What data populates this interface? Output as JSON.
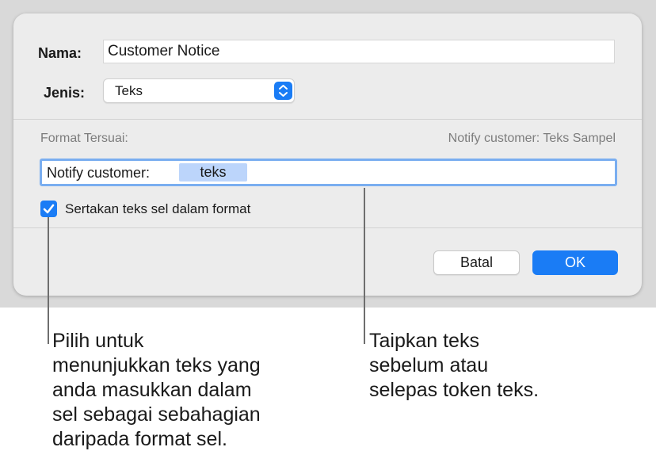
{
  "dialog": {
    "name_label": "Nama:",
    "name_value": "Customer Notice",
    "type_label": "Jenis:",
    "type_value": "Teks",
    "custom_format_label": "Format Tersuai:",
    "sample_text": "Notify customer: Teks Sampel",
    "format_prefix": "Notify customer:",
    "token_label": "teks",
    "include_text_checked": true,
    "include_text_label": "Sertakan teks sel dalam format",
    "cancel_label": "Batal",
    "ok_label": "OK"
  },
  "callouts": {
    "left": "Pilih untuk\nmenunjukkan teks yang\nanda masukkan dalam\nsel sebagai sebahagian\ndaripada format sel.",
    "right": "Taipkan teks\nsebelum atau\nselepas token teks."
  },
  "colors": {
    "accent": "#1a7cf5",
    "token_fill": "#bcd5fb",
    "focus_ring": "#7aaef0",
    "dialog_bg": "#ececec"
  },
  "icons": {
    "popup": "up-down-chevron-icon",
    "checkbox": "checkmark-icon"
  }
}
